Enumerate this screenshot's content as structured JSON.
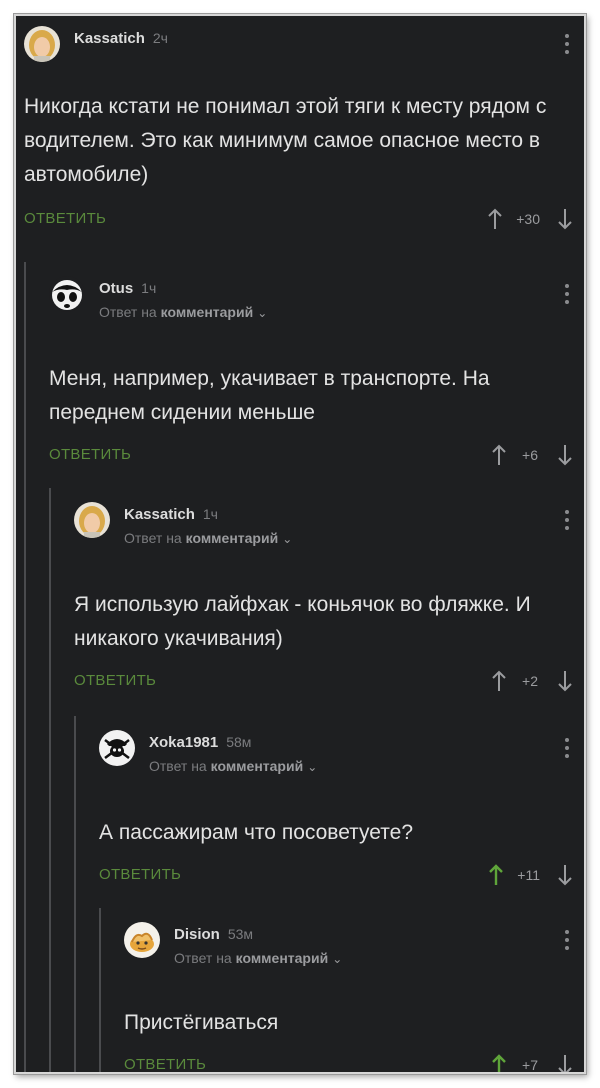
{
  "colors": {
    "background": "#1e1f21",
    "reply_green": "#5a8a3c",
    "upvote_active": "#5fa53a",
    "text": "#e3e3e3",
    "muted": "#7b7c7f"
  },
  "comments": [
    {
      "author": "Kassatich",
      "time": "2ч",
      "reply_prefix": "",
      "reply_target": "",
      "text": "Никогда кстати не понимал этой тяги к месту рядом с водителем. Это как минимум самое опасное место в автомобиле)",
      "reply_label": "ОТВЕТИТЬ",
      "score": "+30",
      "upvoted": false,
      "avatar_icon": "blond-person-avatar"
    },
    {
      "author": "Otus",
      "time": "1ч",
      "reply_prefix": "Ответ на",
      "reply_target": "комментарий",
      "text": "Меня, например, укачивает в транспорте. На переднем сидении меньше",
      "reply_label": "ОТВЕТИТЬ",
      "score": "+6",
      "upvoted": false,
      "avatar_icon": "panda-avatar"
    },
    {
      "author": "Kassatich",
      "time": "1ч",
      "reply_prefix": "Ответ на",
      "reply_target": "комментарий",
      "text": "Я использую лайфхак - коньячок во фляжке. И никакого укачивания)",
      "reply_label": "ОТВЕТИТЬ",
      "score": "+2",
      "upvoted": false,
      "avatar_icon": "blond-person-avatar"
    },
    {
      "author": "Xoka1981",
      "time": "58м",
      "reply_prefix": "Ответ на",
      "reply_target": "комментарий",
      "text": "А пассажирам что посоветуете?",
      "reply_label": "ОТВЕТИТЬ",
      "score": "+11",
      "upvoted": true,
      "avatar_icon": "pirate-skull-avatar"
    },
    {
      "author": "Dision",
      "time": "53м",
      "reply_prefix": "Ответ на",
      "reply_target": "комментарий",
      "text": "Пристёгиваться",
      "reply_label": "ОТВЕТИТЬ",
      "score": "+7",
      "upvoted": true,
      "avatar_icon": "cartoon-character-avatar"
    }
  ]
}
